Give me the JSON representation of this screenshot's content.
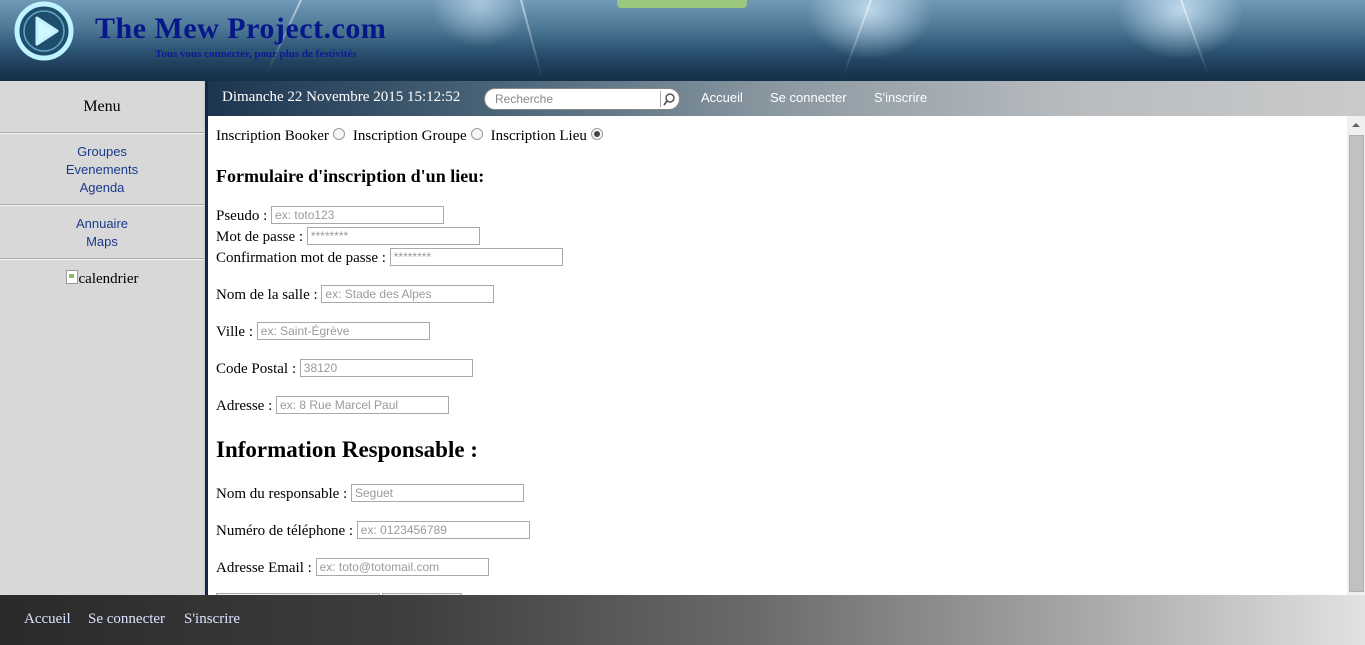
{
  "header": {
    "title": "The Mew Project.com",
    "tagline": "Tous vous connecter, pour plus de festivités",
    "logo_icon": "play-circle-icon"
  },
  "sidebar": {
    "menu_title": "Menu",
    "group1": [
      "Groupes",
      "Evenements",
      "Agenda"
    ],
    "group2": [
      "Annuaire",
      "Maps"
    ],
    "calendar_alt": "calendrier"
  },
  "navbar": {
    "datetime": "Dimanche 22 Novembre 2015 15:12:52",
    "search_placeholder": "Recherche",
    "links": [
      "Accueil",
      "Se connecter",
      "S'inscrire"
    ]
  },
  "form": {
    "radio_options": [
      {
        "label": "Inscription Booker",
        "checked": false
      },
      {
        "label": "Inscription Groupe",
        "checked": false
      },
      {
        "label": "Inscription Lieu",
        "checked": true
      }
    ],
    "title": "Formulaire d'inscription d'un lieu:",
    "fields": {
      "pseudo": {
        "label": "Pseudo :",
        "placeholder": "ex: toto123"
      },
      "password": {
        "label": "Mot de passe :",
        "placeholder": "********"
      },
      "password_confirm": {
        "label": "Confirmation mot de passe :",
        "placeholder": "********"
      },
      "venue_name": {
        "label": "Nom de la salle :",
        "placeholder": "ex: Stade des Alpes"
      },
      "city": {
        "label": "Ville :",
        "placeholder": "ex: Saint-Égrève"
      },
      "postal_code": {
        "label": "Code Postal :",
        "placeholder": "38120"
      },
      "address": {
        "label": "Adresse :",
        "placeholder": "ex: 8 Rue Marcel Paul"
      }
    },
    "responsible_title": "Information Responsable :",
    "responsible_fields": {
      "name": {
        "label": "Nom du responsable :",
        "placeholder": "Seguet"
      },
      "phone": {
        "label": "Numéro de téléphone :",
        "placeholder": "ex: 0123456789"
      },
      "email": {
        "label": "Adresse Email :",
        "placeholder": "ex: toto@totomail.com"
      }
    }
  },
  "footer": {
    "links": [
      "Accueil",
      "Se connecter",
      "S'inscrire"
    ]
  }
}
